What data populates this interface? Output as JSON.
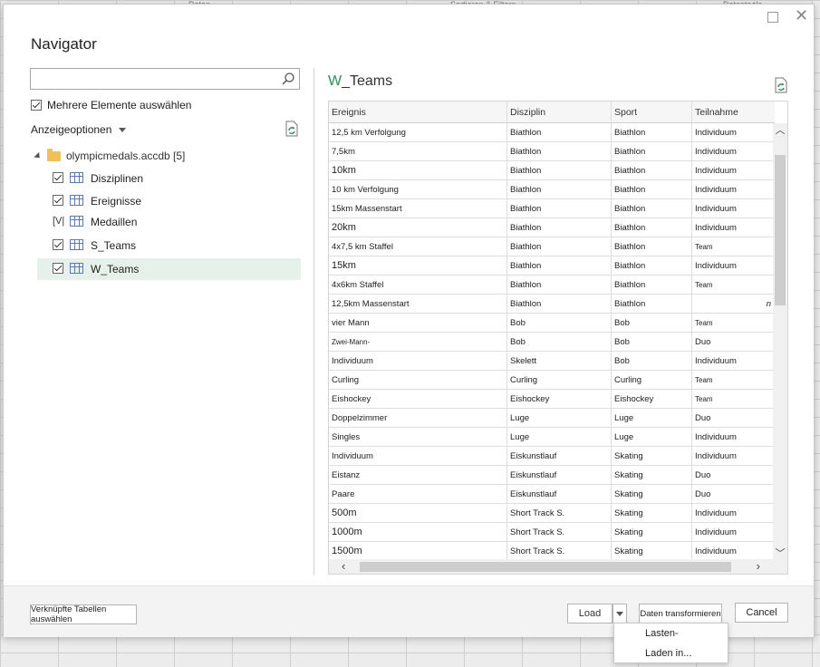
{
  "background": {
    "headers": [
      "Daten",
      "Sortieren & Filtern",
      "Datentools"
    ]
  },
  "dialog": {
    "title": "Navigator"
  },
  "left": {
    "search": {
      "value": "",
      "placeholder": ""
    },
    "multi_select_label": "Mehrere Elemente auswählen",
    "options_label": "Anzeigeoptionen",
    "tree": {
      "root_label": "olympicmedals.accdb [5]",
      "items": [
        {
          "label": "Disziplinen",
          "checked": true
        },
        {
          "label": "Ereignisse",
          "checked": true
        },
        {
          "label": "Medaillen",
          "checked": false,
          "marker": "[V|"
        },
        {
          "label": "S_Teams",
          "checked": true
        },
        {
          "label": "W_Teams",
          "checked": true,
          "selected": true
        }
      ]
    }
  },
  "preview": {
    "title_first": "W",
    "title_rest": "_Teams",
    "columns": [
      "Ereignis",
      "Disziplin",
      "Sport",
      "Teilnahme"
    ],
    "rows": [
      [
        "12,5 km Verfolgung",
        "Biathlon",
        "Biathlon",
        "Individuum"
      ],
      [
        "7,5km",
        "Biathlon",
        "Biathlon",
        "Individuum"
      ],
      [
        "10km",
        "Biathlon",
        "Biathlon",
        "Individuum"
      ],
      [
        "10 km Verfolgung",
        "Biathlon",
        "Biathlon",
        "Individuum"
      ],
      [
        "15km Massenstart",
        "Biathlon",
        "Biathlon",
        "Individuum"
      ],
      [
        "20km",
        "Biathlon",
        "Biathlon",
        "Individuum"
      ],
      [
        "4x7,5 km Staffel",
        "Biathlon",
        "Biathlon",
        "Team"
      ],
      [
        "15km",
        "Biathlon",
        "Biathlon",
        "Individuum"
      ],
      [
        "4x6km Staffel",
        "Biathlon",
        "Biathlon",
        "Team"
      ],
      [
        "12,5km Massenstart",
        "Biathlon",
        "Biathlon",
        "n"
      ],
      [
        "vier Mann",
        "Bob",
        "Bob",
        "Team"
      ],
      [
        "Zwei-Mann-",
        "Bob",
        "Bob",
        "Duo"
      ],
      [
        "Individuum",
        "Skelett",
        "Bob",
        "Individuum"
      ],
      [
        "Curling",
        "Curling",
        "Curling",
        "Team"
      ],
      [
        "Eishockey",
        "Eishockey",
        "Eishockey",
        "Team"
      ],
      [
        "Doppelzimmer",
        "Luge",
        "Luge",
        "Duo"
      ],
      [
        "Singles",
        "Luge",
        "Luge",
        "Individuum"
      ],
      [
        "Individuum",
        "Eiskunstlauf",
        "Skating",
        "Individuum"
      ],
      [
        "Eistanz",
        "Eiskunstlauf",
        "Skating",
        "Duo"
      ],
      [
        "Paare",
        "Eiskunstlauf",
        "Skating",
        "Duo"
      ],
      [
        "500m",
        "Short Track S.",
        "Skating",
        "Individuum"
      ],
      [
        "1000m",
        "Short Track S.",
        "Skating",
        "Individuum"
      ],
      [
        "1500m",
        "Short Track S.",
        "Skating",
        "Individuum"
      ]
    ]
  },
  "footer": {
    "linked_tables_label": "Verknüpfte Tabellen auswählen",
    "load_label": "Load",
    "transform_label": "Daten transformieren",
    "cancel_label": "Cancel"
  },
  "load_menu": {
    "items": [
      "Lasten-",
      "Laden in..."
    ]
  }
}
